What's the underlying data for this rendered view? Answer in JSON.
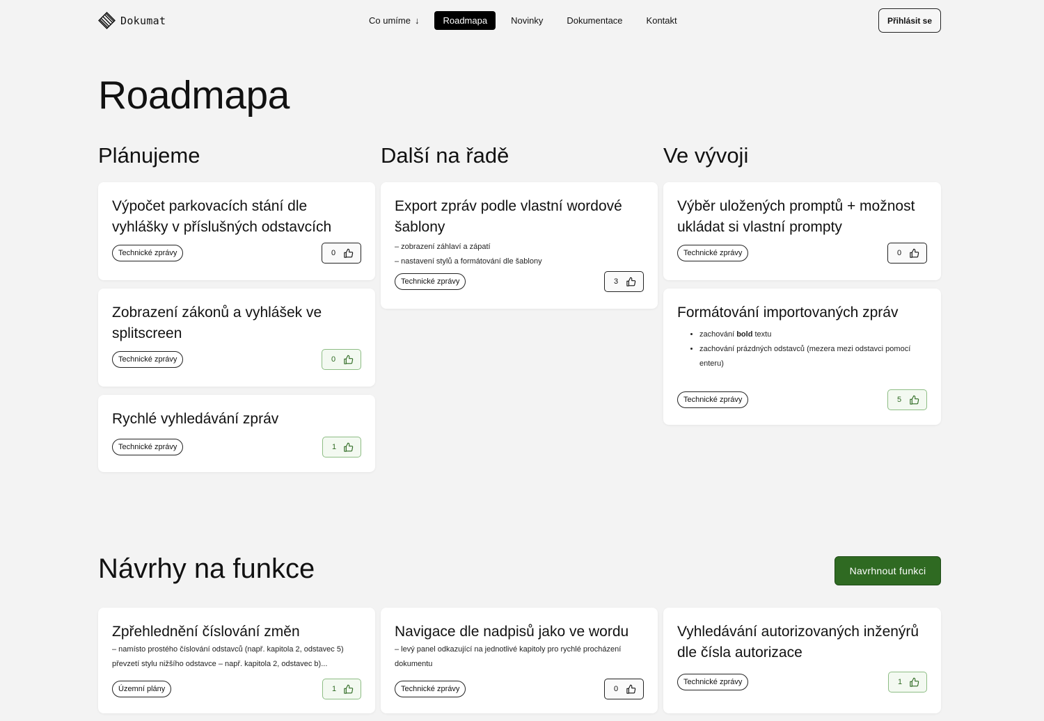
{
  "header": {
    "logo_text": "Dokumat",
    "nav": [
      {
        "label": "Co umíme",
        "has_arrow": true
      },
      {
        "label": "Roadmapa",
        "active": true
      },
      {
        "label": "Novinky"
      },
      {
        "label": "Dokumentace"
      },
      {
        "label": "Kontakt"
      }
    ],
    "nav_arrow": "↓",
    "login_label": "Přihlásit se"
  },
  "page_title": "Roadmapa",
  "columns": [
    {
      "title": "Plánujeme",
      "cards": [
        {
          "title": "Výpočet parkovacích stání dle vyhlášky v příslušných odstavcích",
          "tag": "Technické zprávy",
          "votes": "0",
          "voted": false
        },
        {
          "title": "Zobrazení zákonů a vyhlášek ve splitscreen",
          "tag": "Technické zprávy",
          "votes": "0",
          "voted": true
        },
        {
          "title": "Rychlé vyhledávání zpráv",
          "tag": "Technické zprávy",
          "votes": "1",
          "voted": true
        }
      ]
    },
    {
      "title": "Další na řadě",
      "cards": [
        {
          "title": "Export zpráv podle vlastní wordové šablony",
          "desc_lines": [
            "– zobrazení záhlaví a zápatí",
            "– nastavení stylů a formátování dle šablony"
          ],
          "tag": "Technické zprávy",
          "votes": "3",
          "voted": false
        }
      ]
    },
    {
      "title": "Ve vývoji",
      "cards": [
        {
          "title": "Výběr uložených promptů + možnost ukládat si vlastní prompty",
          "tag": "Technické zprávy",
          "votes": "0",
          "voted": false
        },
        {
          "title": "Formátování importovaných zpráv",
          "list": [
            {
              "pre": "zachování ",
              "bold": "bold",
              "post": " textu"
            },
            {
              "pre": "zachování prázdných odstavců (mezera mezi odstavci pomocí enteru)",
              "bold": "",
              "post": ""
            }
          ],
          "tag": "Technické zprávy",
          "votes": "5",
          "voted": true
        }
      ]
    }
  ],
  "suggestions": {
    "title": "Návrhy na funkce",
    "button_label": "Navrhnout funkci",
    "cards": [
      {
        "title": "Zpřehlednění číslování změn",
        "desc": "– namísto prostého číslování odstavců (např. kapitola 2, odstavec 5) převzetí stylu nižšího odstavce – např. kapitola 2, odstavec b)...",
        "tag": "Územní plány",
        "votes": "1",
        "voted": true
      },
      {
        "title": "Navigace dle nadpisů jako ve wordu",
        "desc": "– levý panel odkazující na jednotlivé kapitoly pro rychlé procházení dokumentu",
        "tag": "Technické zprávy",
        "votes": "0",
        "voted": false
      },
      {
        "title": "Vyhledávání autorizovaných inženýrů dle čísla autorizace",
        "tag": "Technické zprávy",
        "votes": "1",
        "voted": true
      }
    ]
  },
  "colors": {
    "accent_green": "#2f6a22",
    "vote_green_border": "#8dbd84",
    "active_nav_bg": "#000000",
    "page_bg": "#f3f3f3"
  }
}
